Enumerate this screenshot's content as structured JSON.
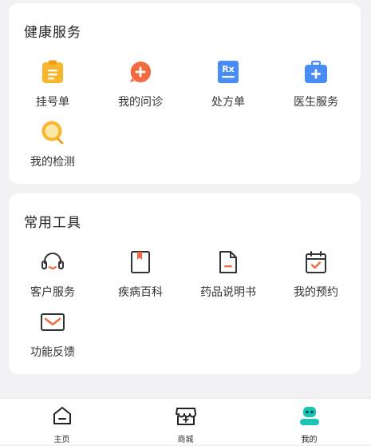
{
  "health": {
    "title": "健康服务",
    "items": [
      {
        "label": "挂号单",
        "icon": "clipboard-icon"
      },
      {
        "label": "我的问诊",
        "icon": "consult-plus-icon"
      },
      {
        "label": "处方单",
        "icon": "rx-icon"
      },
      {
        "label": "医生服务",
        "icon": "medical-kit-icon"
      },
      {
        "label": "我的检测",
        "icon": "magnifier-icon"
      }
    ]
  },
  "tools": {
    "title": "常用工具",
    "items": [
      {
        "label": "客户服务",
        "icon": "headset-icon"
      },
      {
        "label": "疾病百科",
        "icon": "book-icon"
      },
      {
        "label": "药品说明书",
        "icon": "document-icon"
      },
      {
        "label": "我的预约",
        "icon": "calendar-check-icon"
      },
      {
        "label": "功能反馈",
        "icon": "mail-icon"
      }
    ]
  },
  "tabbar": {
    "active": "我的",
    "items": [
      {
        "label": "主页",
        "icon": "home-icon"
      },
      {
        "label": "商城",
        "icon": "store-icon"
      },
      {
        "label": "我的",
        "icon": "profile-robot-icon"
      }
    ]
  },
  "colors": {
    "accent_orange": "#f26a3d",
    "yellow": "#f8b62d",
    "blue": "#4a8cf7",
    "teal": "#19c4b4"
  }
}
